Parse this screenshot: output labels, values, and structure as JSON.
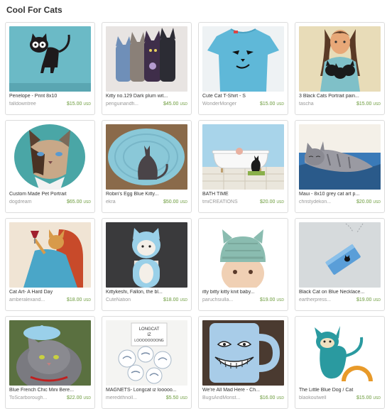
{
  "treasury": {
    "title": "Cool For Cats"
  },
  "colors": {
    "price": "#6a9a3a",
    "shop": "#999999",
    "border": "#dcdcdc"
  },
  "items": [
    {
      "name": "Penelope - Print 8x10",
      "shop": "falldowntree",
      "price": "$15.00",
      "currency": "USD",
      "image": "black-cat-on-teal-illustration"
    },
    {
      "name": "Kitty no.129 Dark plum wit...",
      "shop": "penguinandfi...",
      "price": "$45.00",
      "currency": "USD",
      "image": "plush-cat-dolls"
    },
    {
      "name": "Cute Cat T-Shirt - S",
      "shop": "WonderMonger",
      "price": "$15.00",
      "currency": "USD",
      "image": "blue-cat-face-tshirt"
    },
    {
      "name": "3 Black Cats Portrait pain...",
      "shop": "tascha",
      "price": "$15.00",
      "currency": "USD",
      "image": "girl-holding-black-cats-painting"
    },
    {
      "name": "Custom Made Pet Portrait",
      "shop": "dogdream",
      "price": "$65.00",
      "currency": "USD",
      "image": "siamese-cat-portrait"
    },
    {
      "name": "Robin's Egg Blue Kitty...",
      "shop": "ekra",
      "price": "$50.00",
      "currency": "USD",
      "image": "blue-knit-rug-with-cat"
    },
    {
      "name": "BATH TIME",
      "shop": "tmiCREATIONS",
      "price": "$20.00",
      "currency": "USD",
      "image": "cat-by-bathtub"
    },
    {
      "name": "Maui - 8x10 grey cat art p...",
      "shop": "christydekon...",
      "price": "$20.00",
      "currency": "USD",
      "image": "grey-cat-lying-art-print"
    },
    {
      "name": "Cat Art- A Hard Day",
      "shop": "amberalexand...",
      "price": "$18.00",
      "currency": "USD",
      "image": "cat-lady-in-blue-dress"
    },
    {
      "name": "Kittykeshi, Fallon, the bl...",
      "shop": "CuteNation",
      "price": "$18.00",
      "currency": "USD",
      "image": "wooden-kokeshi-cat"
    },
    {
      "name": "itty bitty kitty knit baby...",
      "shop": "paruchsiulla...",
      "price": "$19.00",
      "currency": "USD",
      "image": "baby-in-knit-cat-hat"
    },
    {
      "name": "Black Cat on Blue Necklace...",
      "shop": "eartherpress...",
      "price": "$19.00",
      "currency": "USD",
      "image": "blue-cat-pendant-necklace"
    },
    {
      "name": "Blue French Chic Mini Bere...",
      "shop": "ToScarborough...",
      "price": "$22.00",
      "currency": "USD",
      "image": "grey-cat-wearing-beret"
    },
    {
      "name": "MAGNETS- Longcat iz looooo...",
      "shop": "meredithnoll...",
      "price": "$5.50",
      "currency": "USD",
      "image": "longcat-magnets"
    },
    {
      "name": "We're All Mad Here - Ch...",
      "shop": "BugsAndMonst...",
      "price": "$16.00",
      "currency": "USD",
      "image": "cheshire-cat-mug"
    },
    {
      "name": "The Little Blue Dog / Cat",
      "shop": "blaokoutwell",
      "price": "$15.00",
      "currency": "USD",
      "image": "teal-cat-illustration"
    }
  ],
  "artwork_text": {
    "longcat_card": "LONGCAT IZ LOOOOOOOONG"
  }
}
